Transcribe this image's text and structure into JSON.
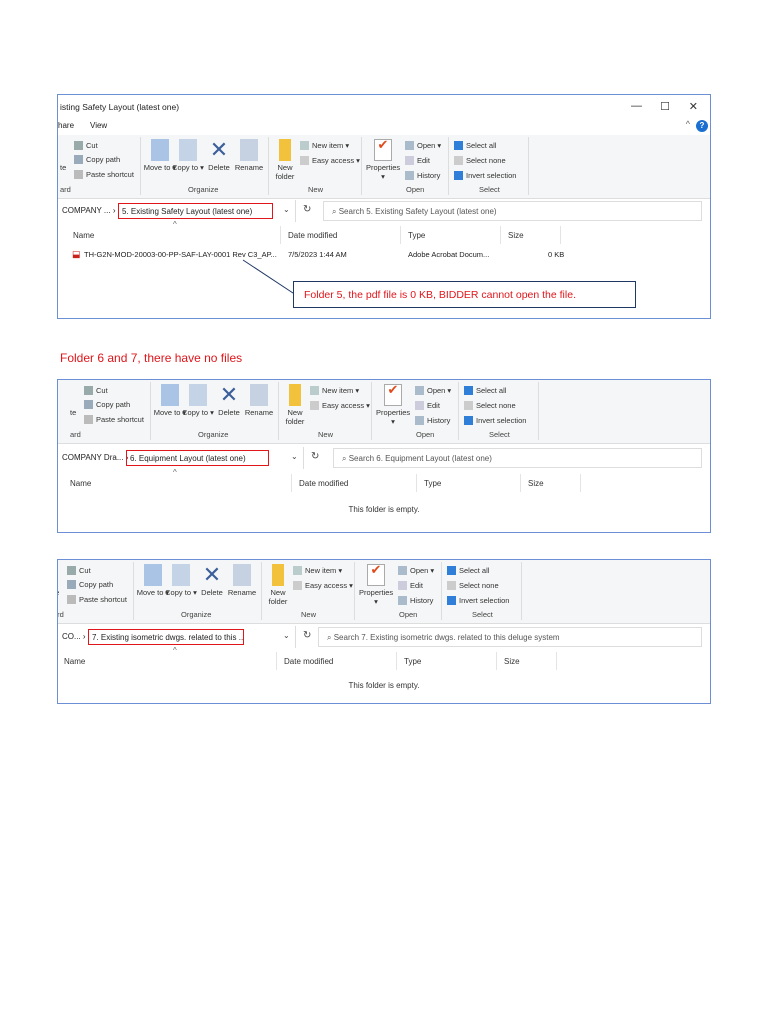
{
  "caption": "Folder 6 and 7, there have no files",
  "ribbon": {
    "clip_partial": "te",
    "clip_group_partial": "ard",
    "cut": "Cut",
    "copy_path": "Copy path",
    "paste_shortcut": "Paste shortcut",
    "move_to": "Move to ▾",
    "copy_to": "Copy to ▾",
    "delete": "Delete",
    "rename": "Rename",
    "organize": "Organize",
    "new_folder": "New folder",
    "new_item": "New item ▾",
    "easy_access": "Easy access ▾",
    "new": "New",
    "properties": "Properties ▾",
    "open_btn": "Open ▾",
    "edit": "Edit",
    "history": "History",
    "open": "Open",
    "select_all": "Select all",
    "select_none": "Select none",
    "invert_selection": "Invert selection",
    "select": "Select"
  },
  "columns": {
    "name": "Name",
    "date": "Date modified",
    "type": "Type",
    "size": "Size"
  },
  "windows": [
    {
      "title": "isting Safety Layout (latest one)",
      "tabs": [
        "hare",
        "View"
      ],
      "crumb": "COMPANY ...  ›",
      "current": "5. Existing Safety Layout (latest one)",
      "search": "Search 5. Existing Safety Layout (latest one)",
      "files": [
        {
          "name": "TH-G2N-MOD-20003-00-PP-SAF-LAY-0001 Rev C3_AP...",
          "date": "7/5/2023 1:44 AM",
          "type": "Adobe Acrobat Docum...",
          "size": "0 KB"
        }
      ],
      "callout": "Folder 5, the pdf file is 0 KB, BIDDER cannot open the file."
    },
    {
      "crumb": "COMPANY Dra...  ›",
      "current": "6. Equipment Layout (latest one)",
      "search": "Search 6. Equipment Layout (latest one)",
      "empty": "This folder is empty."
    },
    {
      "crumb": "CO...  ›",
      "current": "7. Existing isometric dwgs. related to this ...",
      "search": "Search 7. Existing isometric dwgs. related to this deluge system",
      "empty": "This folder is empty."
    }
  ]
}
